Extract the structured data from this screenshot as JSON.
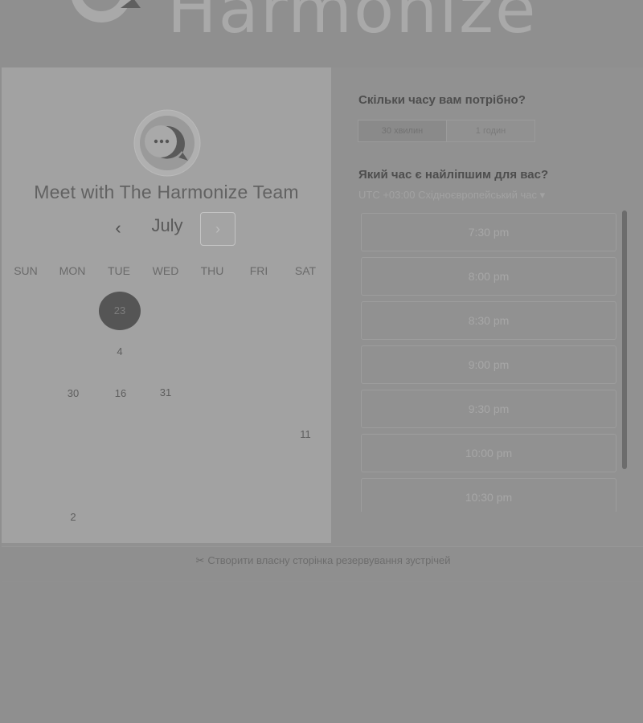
{
  "header": {
    "brand": "Harmonize",
    "logo_icon": "chat-bubble-logo"
  },
  "booking": {
    "title": "Meet with The Harmonize Team",
    "month": "July",
    "prev_icon": "‹",
    "next_icon": "›",
    "weekdays": [
      "SUN",
      "MON",
      "TUE",
      "WED",
      "THU",
      "FRI",
      "SAT"
    ],
    "days": {
      "d23": "23",
      "d4": "4",
      "d30": "30",
      "d16": "16",
      "d31": "31",
      "d11": "11",
      "d2": "2"
    }
  },
  "duration": {
    "question": "Скільки часу вам потрібно?",
    "options": [
      "30 хвилин",
      "1 годин"
    ],
    "selected": "30 хвилин"
  },
  "time": {
    "question": "Який час є найліпшим для вас?",
    "timezone": "UTC +03:00 Східноєвропейський час ▾",
    "slots": [
      "7:30 pm",
      "8:00 pm",
      "8:30 pm",
      "9:00 pm",
      "9:30 pm",
      "10:00 pm",
      "10:30 pm"
    ]
  },
  "footer": {
    "link": "Створити власну сторінка резервування зустрічей",
    "icon": "✂"
  }
}
